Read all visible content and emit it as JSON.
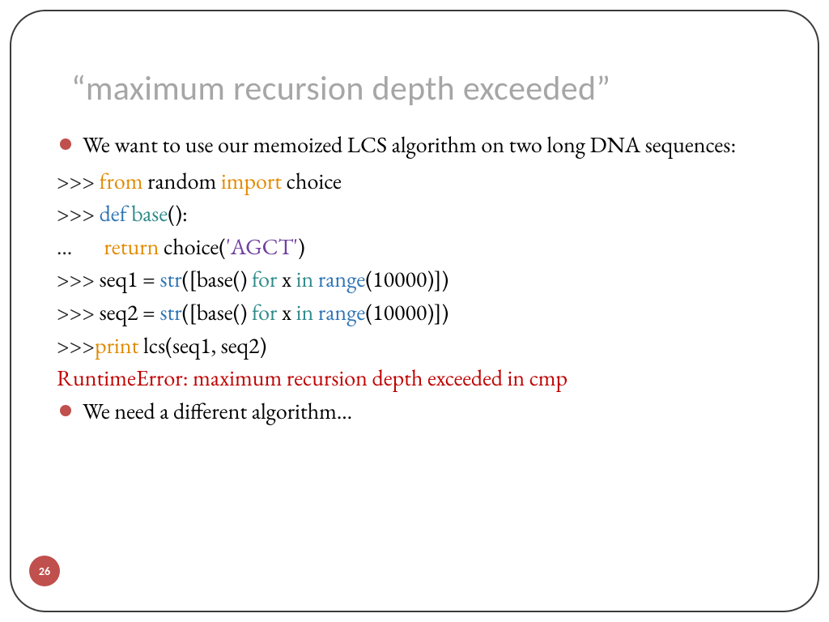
{
  "title": "“maximum recursion depth exceeded”",
  "bullet1": "We want to use our memoized LCS algorithm on two long DNA sequences:",
  "bullet2": "We need a different algorithm…",
  "code": {
    "l1": {
      "prompt": ">>> ",
      "kw1": "from",
      "p1": " random ",
      "kw2": "import",
      "p2": " choice"
    },
    "l2": {
      "prompt": ">>> ",
      "kw1": "def",
      "sp": " ",
      "fn": "base",
      "p2": "():"
    },
    "l3": {
      "prompt": "…       ",
      "kw1": "return",
      "p1": " choice(",
      "str": "'AGCT'",
      "p2": ")"
    },
    "l4": {
      "prompt": ">>> ",
      "p1": "seq1 = ",
      "kw_str": "str",
      "p2": "([base() ",
      "kw_for": "for",
      "p3": " x ",
      "kw_in": "in",
      "p4": " ",
      "kw_range": "range",
      "p5": "(10000)])"
    },
    "l5": {
      "prompt": ">>> ",
      "p1": "seq2 = ",
      "kw_str": "str",
      "p2": "([base() ",
      "kw_for": "for",
      "p3": " x ",
      "kw_in": "in",
      "p4": " ",
      "kw_range": "range",
      "p5": "(10000)])"
    },
    "l6": {
      "prompt": ">>>",
      "kw": "print",
      "p1": " lcs(seq1, seq2)"
    },
    "err": "RuntimeError: maximum recursion depth exceeded in cmp"
  },
  "page_number": "26"
}
